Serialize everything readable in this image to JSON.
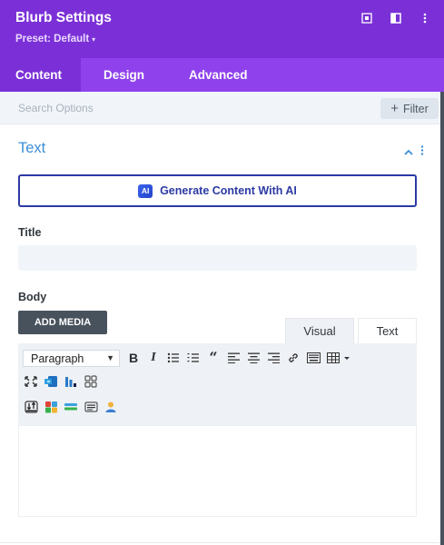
{
  "header": {
    "title": "Blurb Settings",
    "preset": "Preset: Default",
    "bg": "#7b30d7"
  },
  "tabs": [
    {
      "label": "Content",
      "active": true
    },
    {
      "label": "Design",
      "active": false
    },
    {
      "label": "Advanced",
      "active": false
    }
  ],
  "search": {
    "placeholder": "Search Options",
    "filter_label": "Filter"
  },
  "section": {
    "title": "Text"
  },
  "ai_button": {
    "badge": "AI",
    "label": "Generate Content With AI"
  },
  "fields": {
    "title_label": "Title",
    "title_value": "",
    "body_label": "Body"
  },
  "editor": {
    "add_media": "ADD MEDIA",
    "tab_visual": "Visual",
    "tab_text": "Text",
    "format_select": "Paragraph",
    "content": ""
  },
  "colors": {
    "accent": "#7b30d7",
    "tab_bar": "#8f42ec",
    "section_title": "#3c8fd8",
    "ai_button": "#2c3aa3"
  }
}
